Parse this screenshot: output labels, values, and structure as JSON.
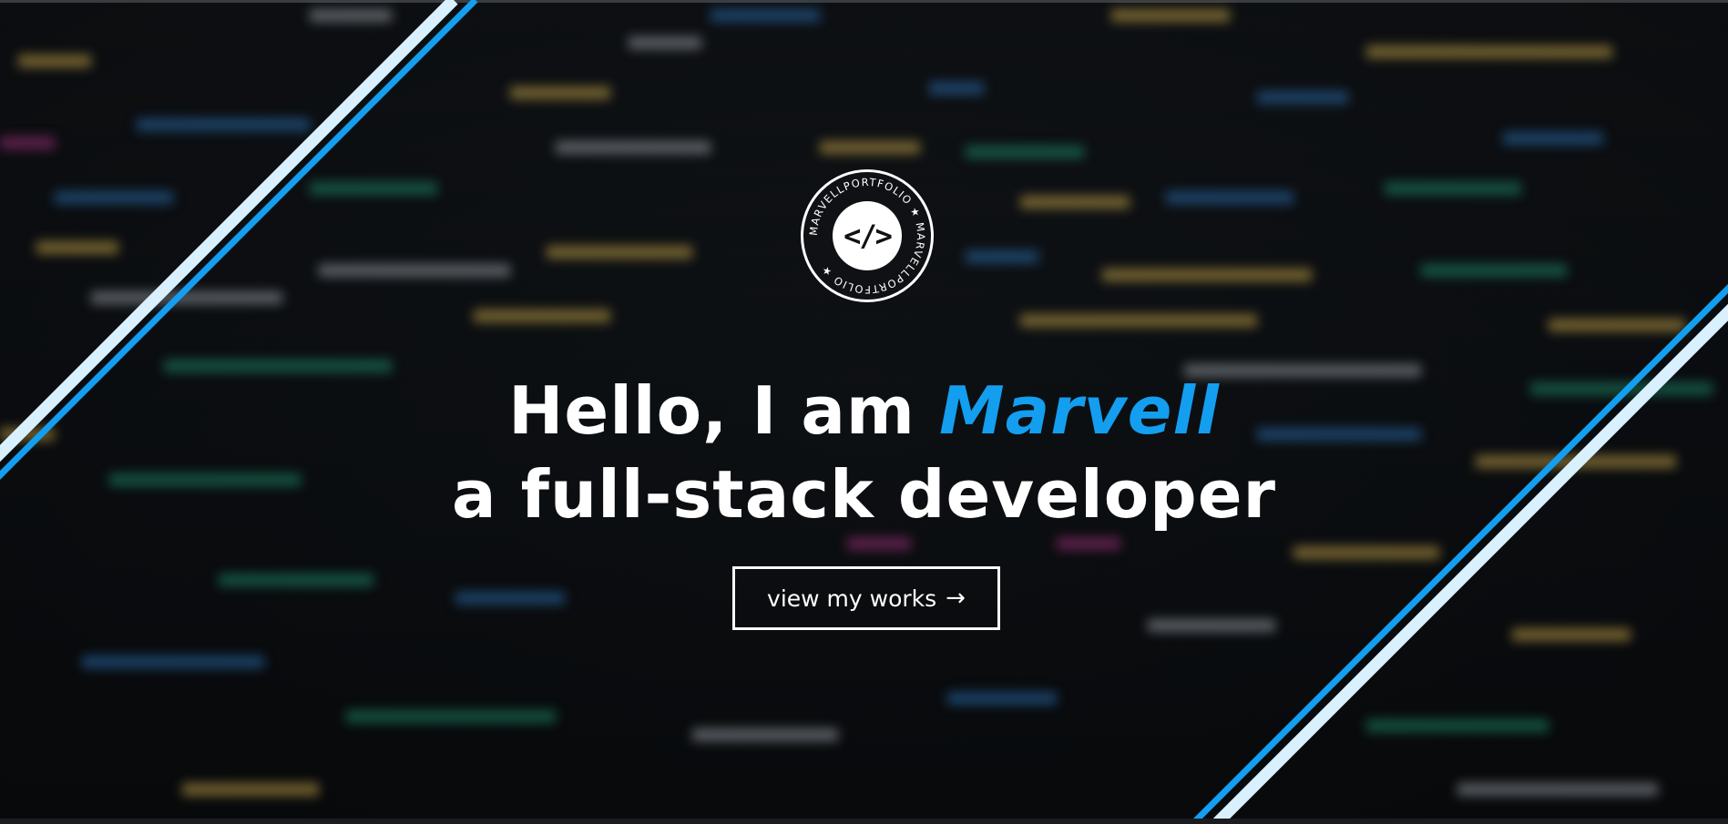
{
  "badge": {
    "ring_text": "MARVELLPORTFOLIO ★ MARVELLPORTFOLIO ★",
    "icon": "code-icon",
    "icon_glyph": "</>"
  },
  "hero": {
    "greeting": "Hello, I am ",
    "name": "Marvell",
    "tagline": "a full-stack developer"
  },
  "cta": {
    "label": "view my works",
    "icon": "arrow-right-icon",
    "icon_glyph": "→"
  },
  "colors": {
    "accent": "#139ef0",
    "stripe_light": "#d9f1ff",
    "text": "#ffffff",
    "background": "#0d1013"
  }
}
